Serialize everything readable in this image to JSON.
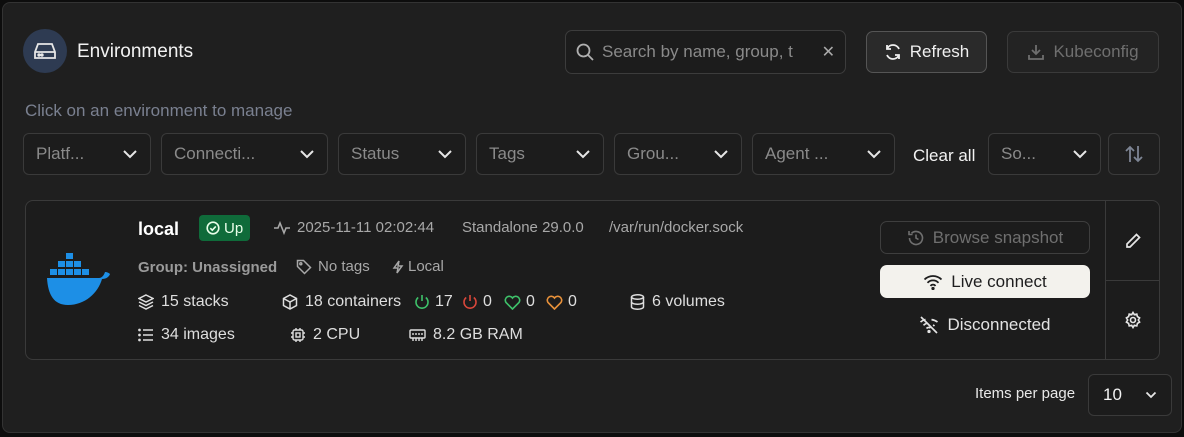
{
  "header": {
    "title": "Environments",
    "search_placeholder": "Search by name, group, t",
    "refresh_label": "Refresh",
    "kubeconfig_label": "Kubeconfig",
    "hint": "Click on an environment to manage"
  },
  "filters": {
    "items": [
      {
        "label": "Platf..."
      },
      {
        "label": "Connecti..."
      },
      {
        "label": "Status"
      },
      {
        "label": "Tags"
      },
      {
        "label": "Grou..."
      },
      {
        "label": "Agent ..."
      }
    ],
    "clear_all": "Clear all",
    "sort_label": "So..."
  },
  "environment": {
    "name": "local",
    "status": "Up",
    "heartbeat": "2025-11-11 02:02:44",
    "type": "Standalone 29.0.0",
    "url": "/var/run/docker.sock",
    "group": "Group: Unassigned",
    "tags": "No tags",
    "mode": "Local",
    "stacks": "15 stacks",
    "containers": "18 containers",
    "running": "17",
    "stopped": "0",
    "healthy": "0",
    "unhealthy": "0",
    "volumes": "6 volumes",
    "images": "34 images",
    "cpu": "2 CPU",
    "ram": "8.2 GB RAM",
    "actions": {
      "snapshot": "Browse snapshot",
      "live": "Live connect",
      "disconnected": "Disconnected"
    }
  },
  "pagination": {
    "items_per_page_label": "Items per page",
    "items_per_page_value": "10"
  },
  "colors": {
    "accent_up": "#0f6b3a",
    "running": "#3ec26a",
    "stopped": "#d9473b",
    "healthy": "#3ec26a",
    "unhealthy": "#e8913a",
    "docker_blue": "#1d8fe6"
  }
}
